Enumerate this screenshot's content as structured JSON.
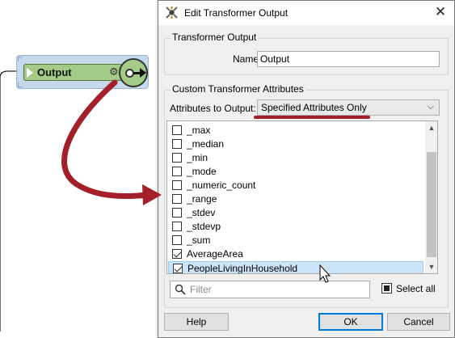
{
  "canvas": {
    "node": {
      "label": "Output"
    }
  },
  "dialog": {
    "title": "Edit Transformer Output",
    "close_symbol": "✕",
    "transformer_output": {
      "group_title": "Transformer Output",
      "name_label": "Name:",
      "name_value": "Output"
    },
    "custom_attributes": {
      "group_title": "Custom Transformer Attributes",
      "attributes_label": "Attributes to Output:",
      "attributes_value": "Specified Attributes Only",
      "items": [
        {
          "label": "_max",
          "checked": false,
          "selected": false
        },
        {
          "label": "_median",
          "checked": false,
          "selected": false
        },
        {
          "label": "_min",
          "checked": false,
          "selected": false
        },
        {
          "label": "_mode",
          "checked": false,
          "selected": false
        },
        {
          "label": "_numeric_count",
          "checked": false,
          "selected": false
        },
        {
          "label": "_range",
          "checked": false,
          "selected": false
        },
        {
          "label": "_stdev",
          "checked": false,
          "selected": false
        },
        {
          "label": "_stdevp",
          "checked": false,
          "selected": false
        },
        {
          "label": "_sum",
          "checked": false,
          "selected": false
        },
        {
          "label": "AverageArea",
          "checked": true,
          "selected": false
        },
        {
          "label": "PeopleLivingInHousehold",
          "checked": true,
          "selected": true
        }
      ],
      "filter_placeholder": "Filter",
      "select_all_label": "Select all"
    },
    "buttons": {
      "help": "Help",
      "ok": "OK",
      "cancel": "Cancel"
    }
  },
  "colors": {
    "annotation_arrow": "#a3202a",
    "node_blue": "#c5d9ea",
    "node_green": "#a4cc88",
    "selection": "#cce4f7"
  },
  "icons": {
    "app": "fme-workbench-icon",
    "gear": "gear-icon",
    "search": "search-icon",
    "cursor": "mouse-pointer-icon"
  }
}
